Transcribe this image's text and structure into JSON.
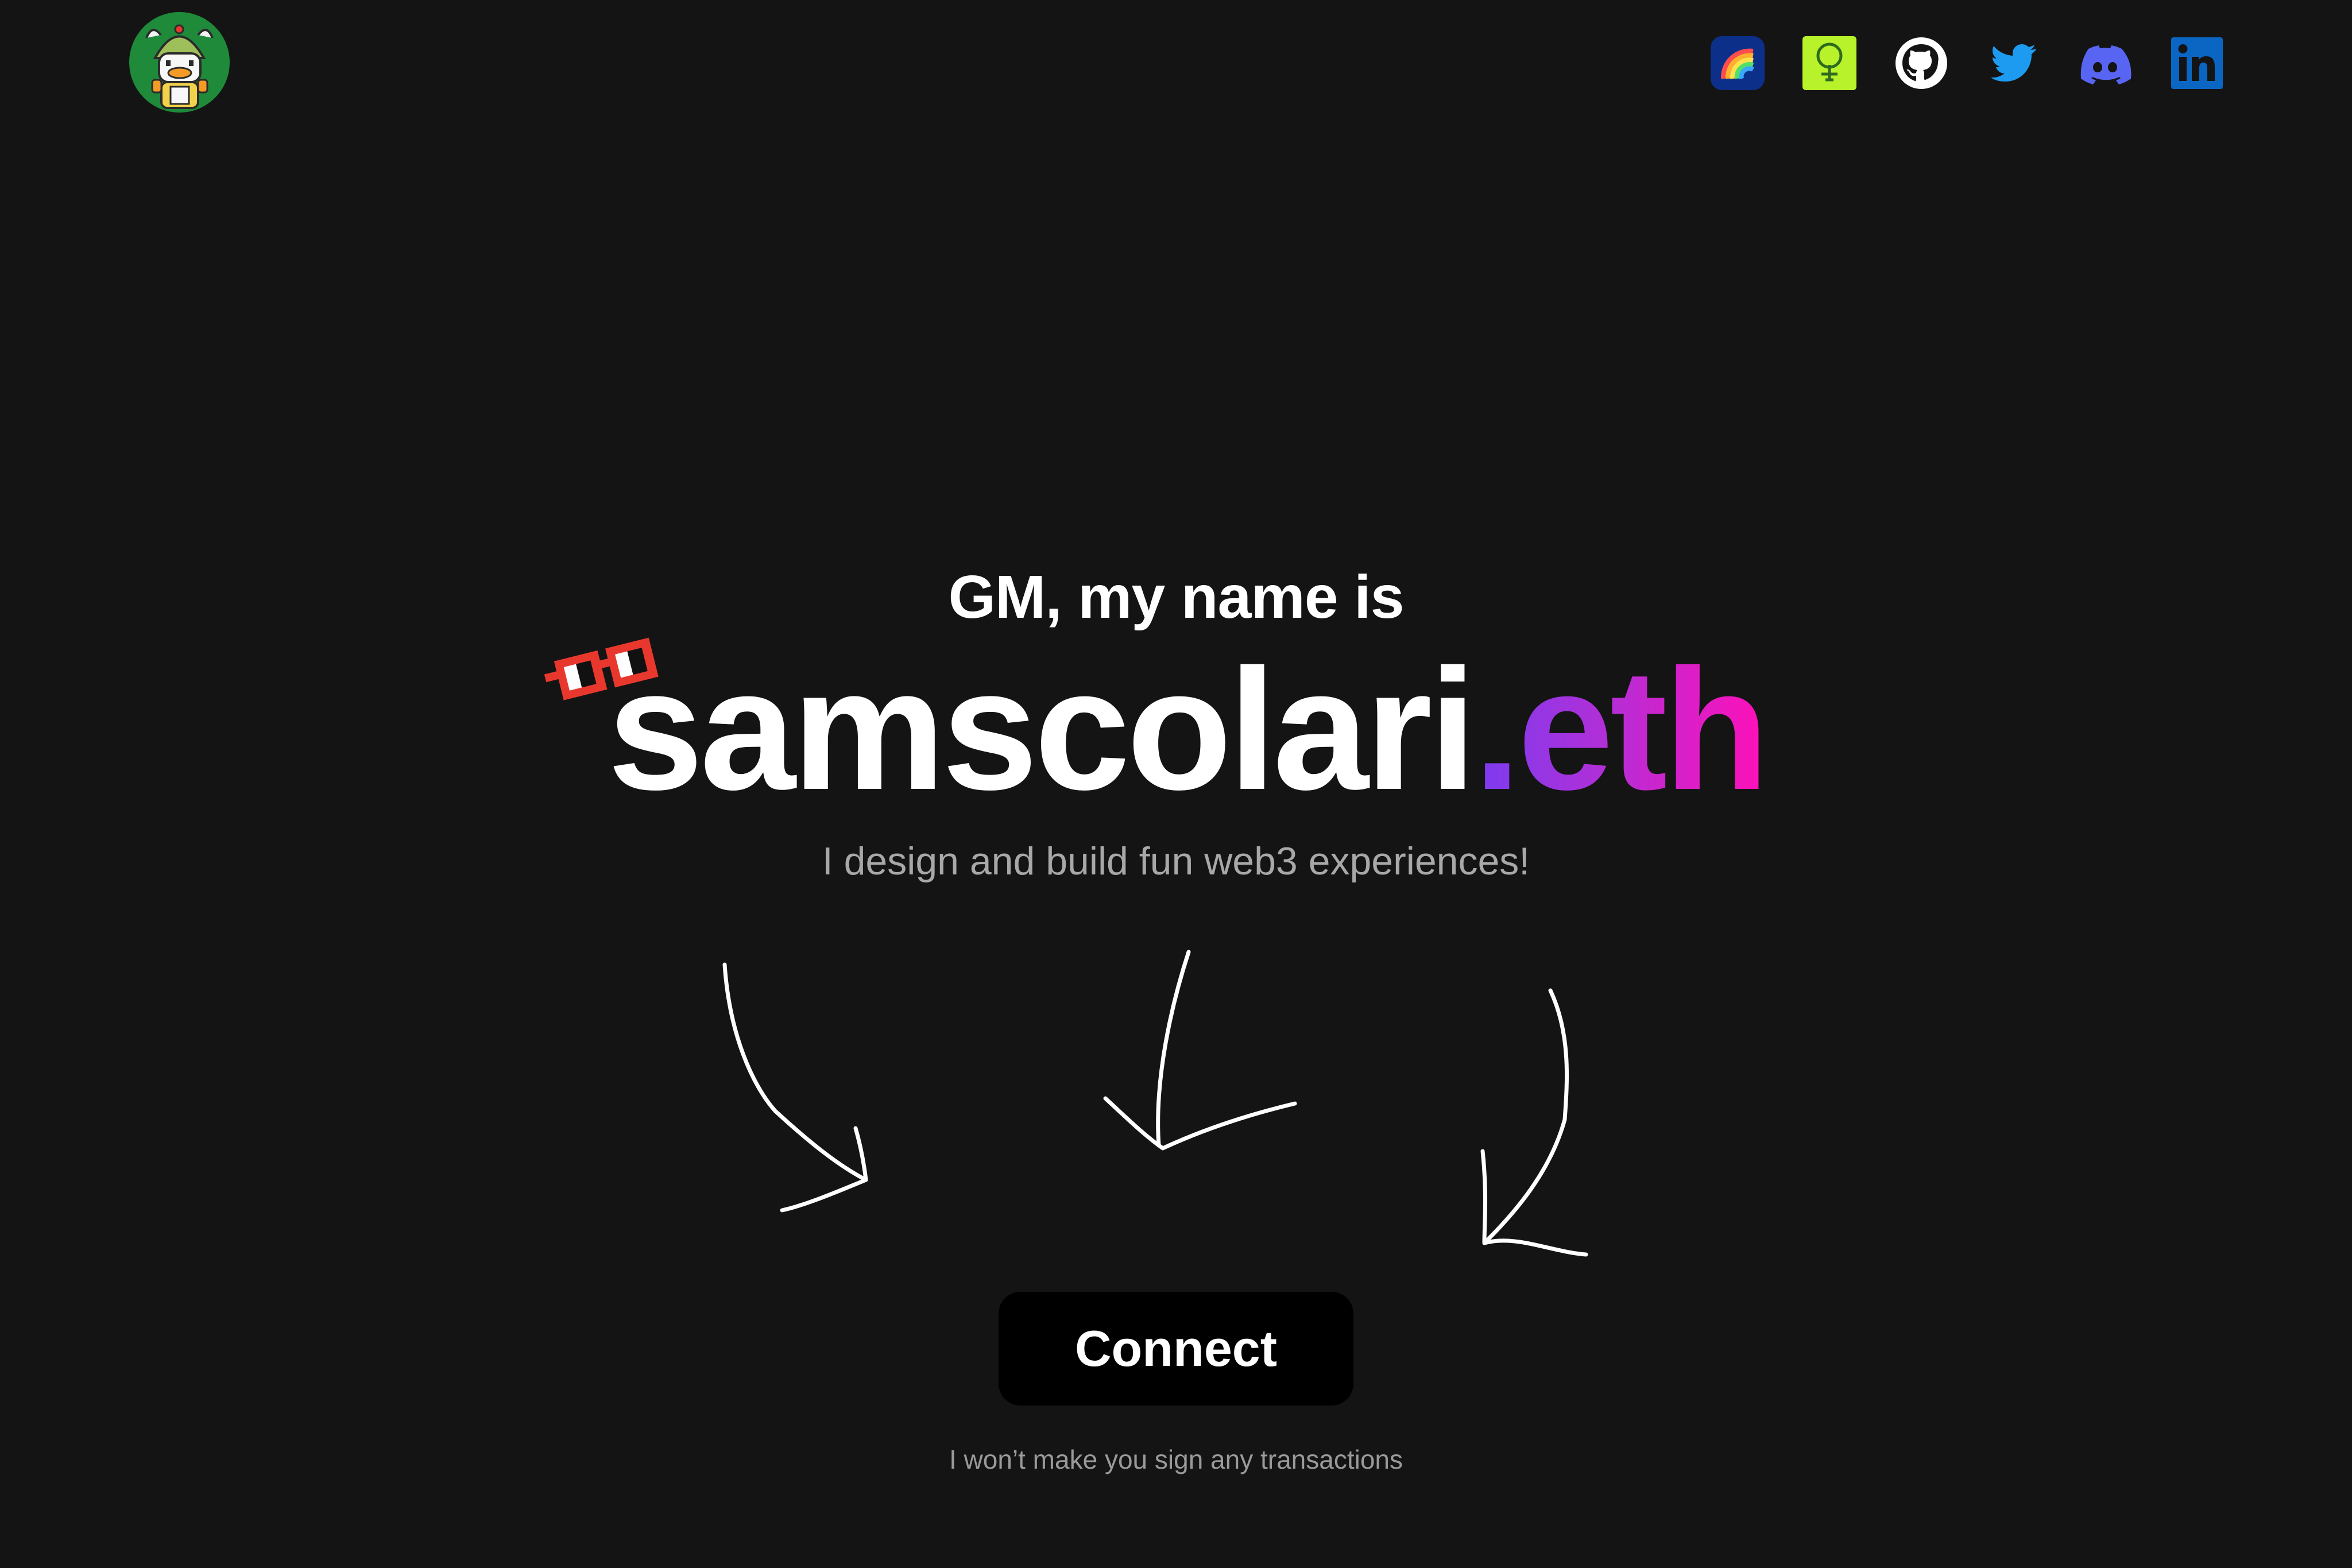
{
  "header": {
    "avatar_icon": "duck-avatar-icon",
    "social_links": [
      {
        "name": "rainbow-icon",
        "bg": "#0c2f8a"
      },
      {
        "name": "treehouse-icon",
        "bg": "#b8f22a"
      },
      {
        "name": "github-icon",
        "bg": "#ffffff"
      },
      {
        "name": "twitter-icon",
        "bg": "#1d9bf0"
      },
      {
        "name": "discord-icon",
        "bg": "#5865f2"
      },
      {
        "name": "linkedin-icon",
        "bg": "#0a66c2"
      }
    ]
  },
  "hero": {
    "greeting": "GM, my name is",
    "name": "samscolari",
    "tld": ".eth",
    "tagline": "I design and build fun web3 experiences!",
    "glasses_icon": "pixel-glasses-icon",
    "arrows_icon": "hand-drawn-arrows-icon"
  },
  "cta": {
    "connect_label": "Connect",
    "note": "I won’t make you sign any transactions"
  },
  "colors": {
    "background": "#141414",
    "gradient_start": "#7a3cf0",
    "gradient_end": "#ff10b8",
    "glasses_red": "#e8382e",
    "button_bg": "#000000"
  }
}
